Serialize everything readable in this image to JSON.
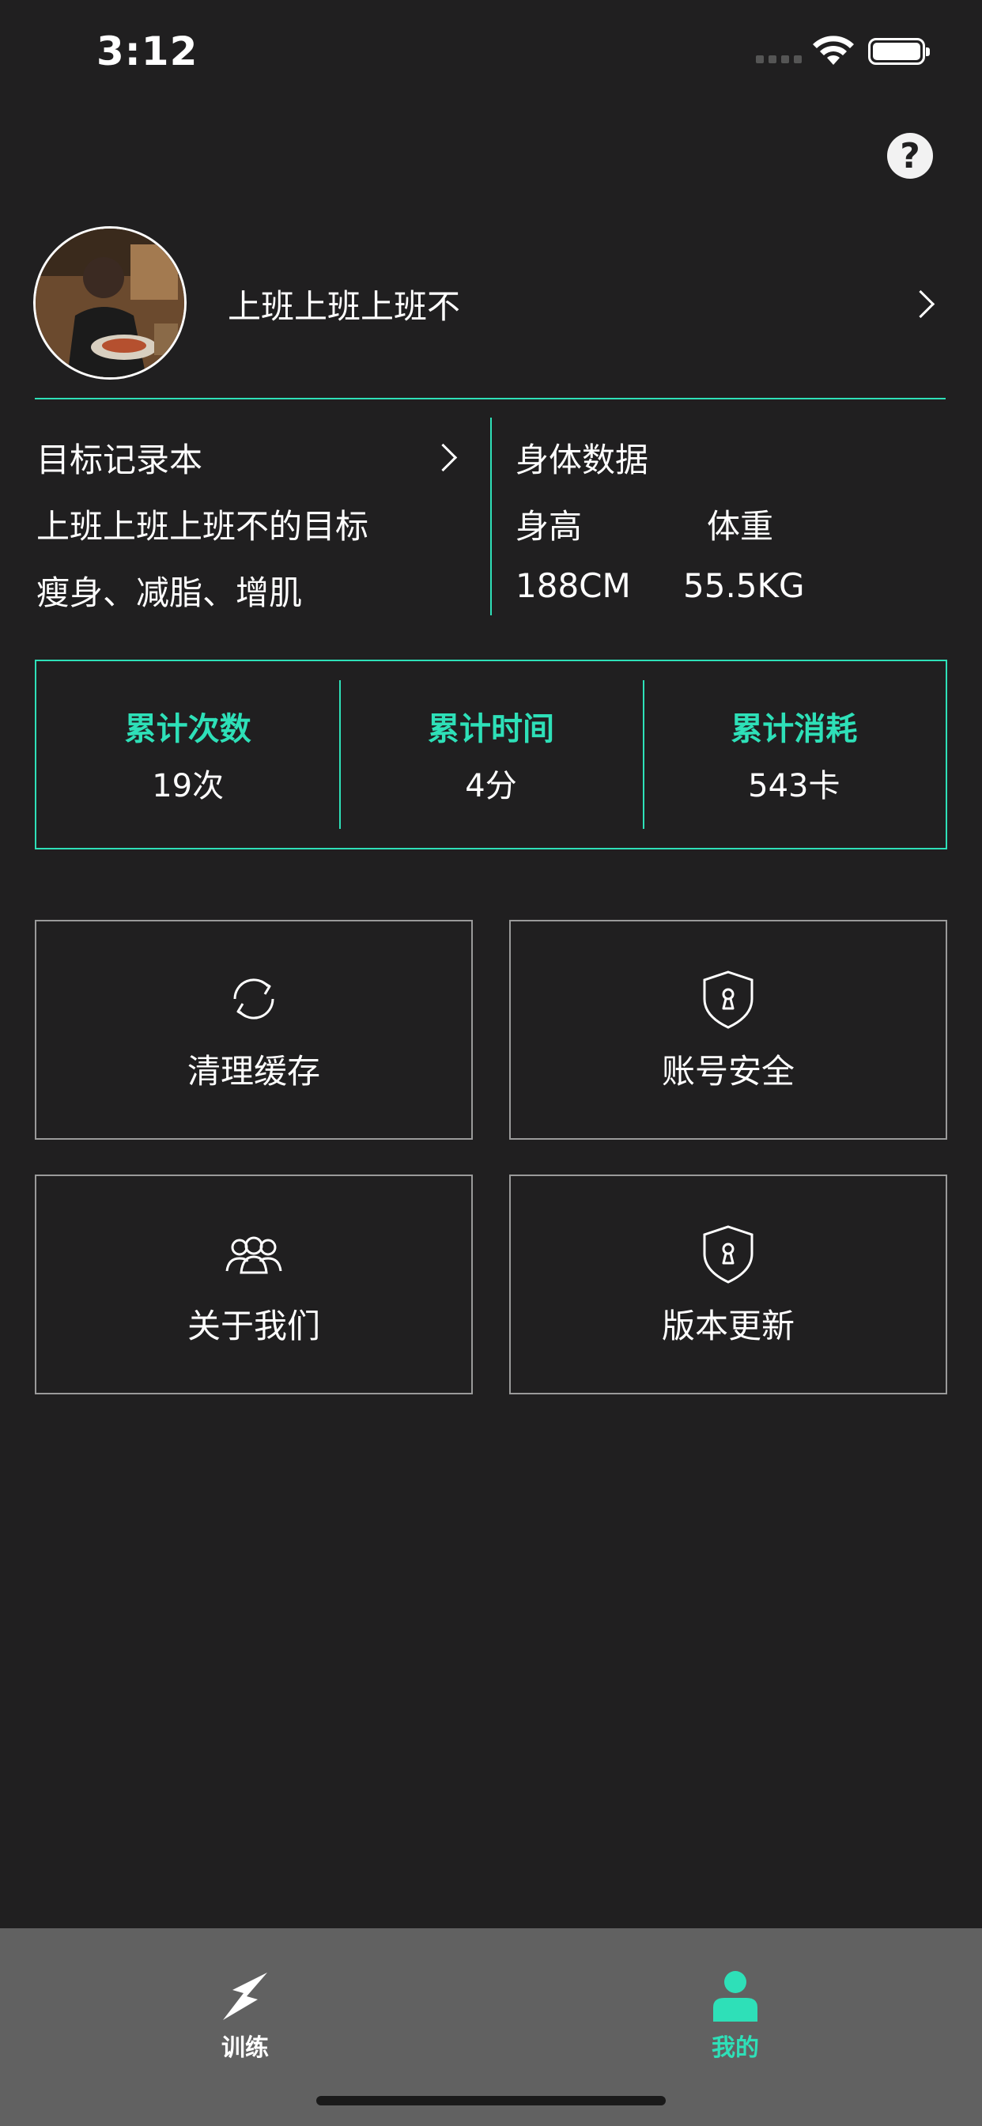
{
  "status_bar": {
    "time": "3:12"
  },
  "header": {
    "help_icon": "help-icon"
  },
  "profile": {
    "username": "上班上班上班不"
  },
  "goals": {
    "title": "目标记录本",
    "subtitle": "上班上班上班不的目标",
    "tags": "瘦身、减脂、增肌"
  },
  "body_data": {
    "title": "身体数据",
    "height_label": "身高",
    "weight_label": "体重",
    "height_value": "188CM",
    "weight_value": "55.5KG"
  },
  "stats": [
    {
      "label": "累计次数",
      "value": "19次"
    },
    {
      "label": "累计时间",
      "value": "4分"
    },
    {
      "label": "累计消耗",
      "value": "543卡"
    }
  ],
  "actions": [
    {
      "label": "清理缓存",
      "icon": "refresh-icon"
    },
    {
      "label": "账号安全",
      "icon": "shield-icon"
    },
    {
      "label": "关于我们",
      "icon": "group-icon"
    },
    {
      "label": "版本更新",
      "icon": "shield-icon"
    }
  ],
  "tabs": [
    {
      "label": "训练",
      "icon": "lightning-icon"
    },
    {
      "label": "我的",
      "icon": "person-icon"
    }
  ],
  "colors": {
    "accent": "#2ee0b8",
    "background": "#201f20",
    "tabbar": "#616161"
  }
}
